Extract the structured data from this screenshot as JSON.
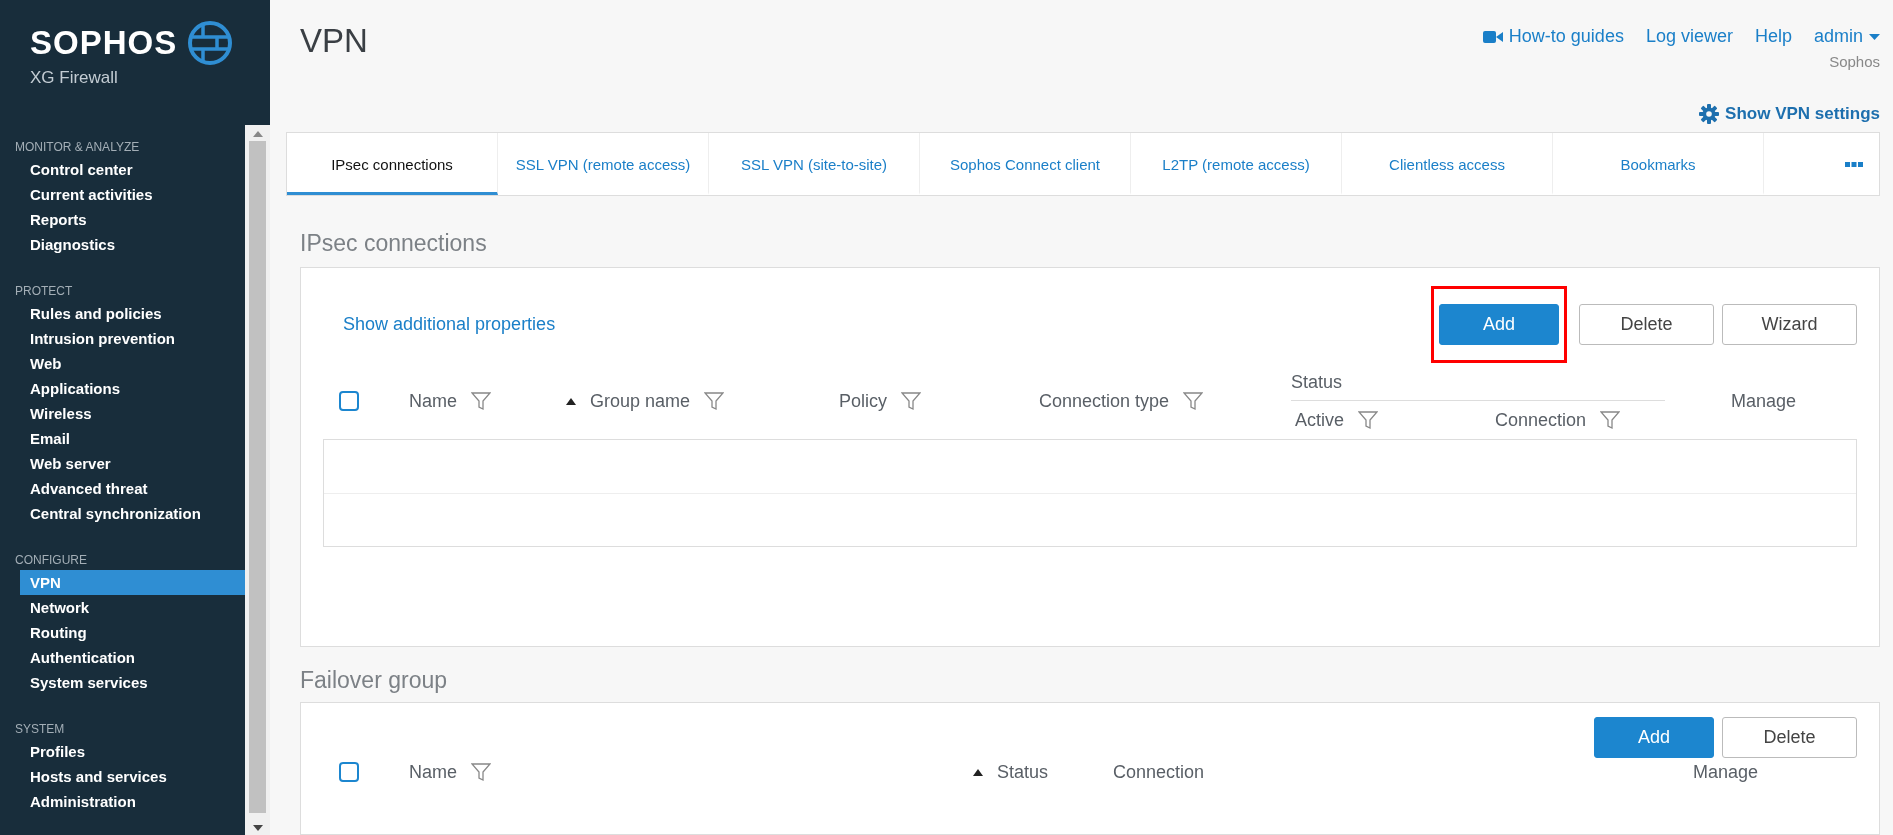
{
  "brand": {
    "name": "SOPHOS",
    "product": "XG Firewall"
  },
  "sidebar": {
    "sections": [
      {
        "title": "MONITOR & ANALYZE",
        "items": [
          {
            "label": "Control center",
            "selected": false
          },
          {
            "label": "Current activities",
            "selected": false
          },
          {
            "label": "Reports",
            "selected": false
          },
          {
            "label": "Diagnostics",
            "selected": false
          }
        ]
      },
      {
        "title": "PROTECT",
        "items": [
          {
            "label": "Rules and policies",
            "selected": false
          },
          {
            "label": "Intrusion prevention",
            "selected": false
          },
          {
            "label": "Web",
            "selected": false
          },
          {
            "label": "Applications",
            "selected": false
          },
          {
            "label": "Wireless",
            "selected": false
          },
          {
            "label": "Email",
            "selected": false
          },
          {
            "label": "Web server",
            "selected": false
          },
          {
            "label": "Advanced threat",
            "selected": false
          },
          {
            "label": "Central synchronization",
            "selected": false
          }
        ]
      },
      {
        "title": "CONFIGURE",
        "items": [
          {
            "label": "VPN",
            "selected": true
          },
          {
            "label": "Network",
            "selected": false
          },
          {
            "label": "Routing",
            "selected": false
          },
          {
            "label": "Authentication",
            "selected": false
          },
          {
            "label": "System services",
            "selected": false
          }
        ]
      },
      {
        "title": "SYSTEM",
        "items": [
          {
            "label": "Profiles",
            "selected": false
          },
          {
            "label": "Hosts and services",
            "selected": false
          },
          {
            "label": "Administration",
            "selected": false
          }
        ]
      }
    ]
  },
  "header": {
    "title": "VPN",
    "links": [
      {
        "label": "How-to guides",
        "kind": "video"
      },
      {
        "label": "Log viewer",
        "kind": "plain"
      },
      {
        "label": "Help",
        "kind": "plain"
      }
    ],
    "user": {
      "name": "admin",
      "org": "Sophos"
    },
    "settings_link": "Show VPN settings"
  },
  "tabs": [
    {
      "label": "IPsec connections",
      "selected": true
    },
    {
      "label": "SSL VPN (remote access)",
      "selected": false
    },
    {
      "label": "SSL VPN (site-to-site)",
      "selected": false
    },
    {
      "label": "Sophos Connect client",
      "selected": false
    },
    {
      "label": "L2TP (remote access)",
      "selected": false
    },
    {
      "label": "Clientless access",
      "selected": false
    },
    {
      "label": "Bookmarks",
      "selected": false
    }
  ],
  "ipsec": {
    "title": "IPsec connections",
    "link": "Show additional properties",
    "buttons": [
      {
        "label": "Add",
        "kind": "primary",
        "highlighted": true
      },
      {
        "label": "Delete",
        "kind": "secondary",
        "highlighted": false
      },
      {
        "label": "Wizard",
        "kind": "secondary",
        "highlighted": false
      }
    ],
    "select_all": {
      "checked": false
    },
    "columns": [
      {
        "label": "Name",
        "filter": true,
        "sorted": false
      },
      {
        "label": "Group name",
        "filter": true,
        "sorted": true
      },
      {
        "label": "Policy",
        "filter": true,
        "sorted": false
      },
      {
        "label": "Connection type",
        "filter": true,
        "sorted": false
      },
      {
        "label": "Status",
        "children": [
          {
            "label": "Active",
            "filter": true,
            "sorted": false
          },
          {
            "label": "Connection",
            "filter": true,
            "sorted": false
          }
        ]
      },
      {
        "label": "Manage",
        "filter": false,
        "sorted": false
      }
    ]
  },
  "failover": {
    "title": "Failover group",
    "buttons": [
      {
        "label": "Add",
        "kind": "primary",
        "highlighted": false
      },
      {
        "label": "Delete",
        "kind": "secondary",
        "highlighted": false
      }
    ],
    "select_all": {
      "checked": false
    },
    "columns": [
      {
        "label": "Name",
        "filter": true,
        "sorted": false
      },
      {
        "label": "Status",
        "filter": false,
        "sorted": true
      },
      {
        "label": "Connection",
        "filter": false,
        "sorted": false
      },
      {
        "label": "Manage",
        "filter": false,
        "sorted": false
      }
    ]
  }
}
